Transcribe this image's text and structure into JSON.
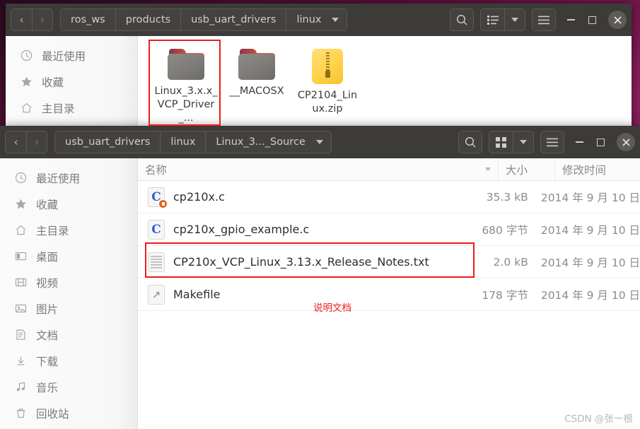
{
  "desktop": {
    "watermark": "CSDN @张一根"
  },
  "window1": {
    "nav": {
      "back": "‹",
      "forward": "›"
    },
    "breadcrumbs": [
      "ros_ws",
      "products",
      "usb_uart_drivers",
      "linux"
    ],
    "toolbar": {
      "search": "search-icon",
      "view": "list-view-icon",
      "view_dropdown": "chevron-down-icon",
      "menu": "hamburger-menu-icon",
      "minimize": "minimize-icon",
      "maximize": "maximize-icon",
      "close": "close-icon"
    },
    "sidebar": [
      {
        "label": "最近使用",
        "icon": "clock-icon"
      },
      {
        "label": "收藏",
        "icon": "star-icon"
      },
      {
        "label": "主目录",
        "icon": "home-icon"
      }
    ],
    "items": [
      {
        "name": "Linux_3.x.x_VCP_Driver_...",
        "icon": "folder-icon",
        "highlighted": true
      },
      {
        "name": "__MACOSX",
        "icon": "folder-icon",
        "highlighted": false
      },
      {
        "name": "CP2104_Linux.zip",
        "icon": "zip-archive-icon",
        "highlighted": false
      }
    ]
  },
  "window2": {
    "nav": {
      "back": "‹",
      "forward": "›"
    },
    "breadcrumbs": [
      "usb_uart_drivers",
      "linux",
      "Linux_3..._Source"
    ],
    "toolbar": {
      "search": "search-icon",
      "view": "grid-view-icon",
      "view_dropdown": "chevron-down-icon",
      "menu": "hamburger-menu-icon",
      "minimize": "minimize-icon",
      "maximize": "maximize-icon",
      "close": "close-icon"
    },
    "sidebar": [
      {
        "label": "最近使用",
        "icon": "clock-icon"
      },
      {
        "label": "收藏",
        "icon": "star-icon"
      },
      {
        "label": "主目录",
        "icon": "home-icon"
      },
      {
        "label": "桌面",
        "icon": "desktop-icon"
      },
      {
        "label": "视频",
        "icon": "video-icon"
      },
      {
        "label": "图片",
        "icon": "image-icon"
      },
      {
        "label": "文档",
        "icon": "document-icon"
      },
      {
        "label": "下载",
        "icon": "download-icon"
      },
      {
        "label": "音乐",
        "icon": "music-icon"
      },
      {
        "label": "回收站",
        "icon": "trash-icon"
      }
    ],
    "columns": {
      "name": "名称",
      "size": "大小",
      "date": "修改时间"
    },
    "rows": [
      {
        "name": "cp210x.c",
        "size": "35.3 kB",
        "date": "2014 年 9 月 10 日",
        "icon": "c-source-locked-icon",
        "highlighted": false
      },
      {
        "name": "cp210x_gpio_example.c",
        "size": "680 字节",
        "date": "2014 年 9 月 10 日",
        "icon": "c-source-icon",
        "highlighted": false
      },
      {
        "name": "CP210x_VCP_Linux_3.13.x_Release_Notes.txt",
        "size": "2.0 kB",
        "date": "2014 年 9 月 10 日",
        "icon": "text-file-icon",
        "highlighted": true
      },
      {
        "name": "Makefile",
        "size": "178 字节",
        "date": "2014 年 9 月 10 日",
        "icon": "makefile-icon",
        "highlighted": false
      }
    ]
  },
  "annotations": {
    "accent_color": "#ee1c1c",
    "note": "说明文档"
  }
}
